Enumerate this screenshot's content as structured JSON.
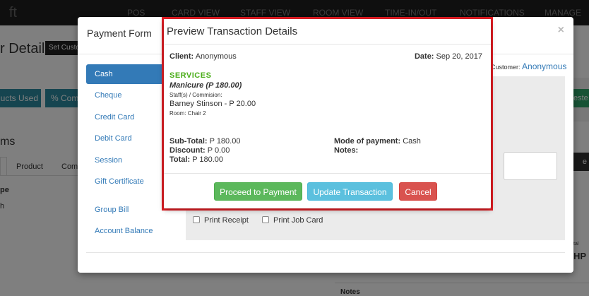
{
  "background": {
    "logo": "ft",
    "nav": [
      "POS",
      "CARD VIEW",
      "STAFF VIEW",
      "ROOM VIEW",
      "TIME-IN/OUT",
      "NOTIFICATIONS",
      "MANAGE"
    ],
    "page_title_fragment": "r Details",
    "set_customer_fragment": "Set Custo",
    "products_used_fragment": "ucts Used",
    "commission_fragment": "% Com",
    "items_fragment": "ms",
    "tabs": [
      "Product",
      "Com"
    ],
    "type_fragment": "pe",
    "row_fragment": "h",
    "right_btn_fragment": "este",
    "right_dark_fragment": "e",
    "right_total_label": "tal",
    "right_total_fragment": "HP",
    "notes_label": "Notes"
  },
  "payment_modal": {
    "title": "Payment Form",
    "close": "×",
    "customer_label": "Customer:",
    "customer_value": "Anonymous",
    "methods": [
      "Cash",
      "Cheque",
      "Credit Card",
      "Debit Card",
      "Session",
      "Gift Certificate",
      "Group Bill",
      "Account Balance"
    ],
    "active_method": "Cash",
    "print_receipt": "Print Receipt",
    "print_job_card": "Print Job Card"
  },
  "preview": {
    "title": "Preview Transaction Details",
    "client_label": "Client:",
    "client_value": "Anonymous",
    "date_label": "Date:",
    "date_value": "Sep 20, 2017",
    "services_heading": "SERVICES",
    "service_name": "Manicure (P 180.00)",
    "staff_label": "Staff(s) / Commision:",
    "staff_value": "Barney Stinson - P 20.00",
    "room": "Room: Chair 2",
    "subtotal_label": "Sub-Total:",
    "subtotal_value": "P 180.00",
    "discount_label": "Discount:",
    "discount_value": "P 0.00",
    "total_label": "Total:",
    "total_value": "P 180.00",
    "mode_label": "Mode of payment:",
    "mode_value": "Cash",
    "notes_label": "Notes:",
    "buttons": {
      "proceed": "Proceed to Payment",
      "update": "Update Transaction",
      "cancel": "Cancel"
    }
  },
  "colors": {
    "primary": "#337ab7",
    "success": "#5cb85c",
    "info": "#5bc0de",
    "danger": "#d9534f",
    "highlight": "#e51e25",
    "services_green": "#4cae1b"
  }
}
